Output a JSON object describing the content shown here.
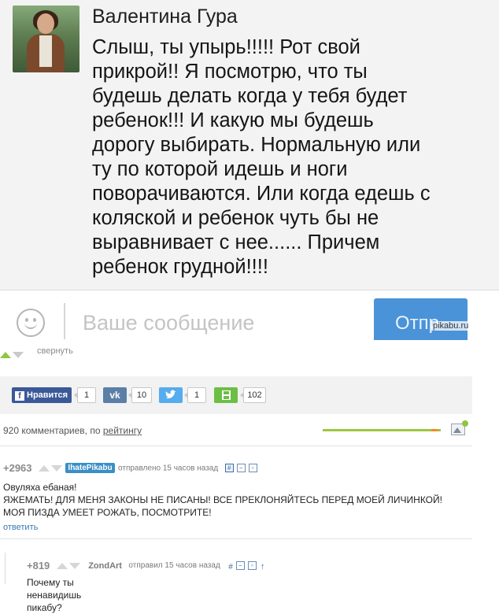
{
  "chat": {
    "sender_name": "Валентина Гура",
    "message_lines": [
      "Слыш, ты упырь!!!!! Рот свой",
      "прикрой!! Я посмотрю, что ты",
      "будешь делать когда у тебя будет",
      "ребенок!!! И какую мы будешь",
      "дорогу выбирать. Нормальную или",
      "ту по которой идешь и ноги",
      "поворачиваются. Или когда едешь с",
      "коляской и ребенок чуть бы не",
      "выравнивает с нее...... Причем",
      "ребенок грудной!!!!"
    ],
    "input_placeholder": "Ваше сообщение",
    "send_label": "Отпр"
  },
  "watermark": "pikabu.ru",
  "post": {
    "collapse_label": "свернуть",
    "share": [
      {
        "label": "Нравится",
        "count": "1",
        "color": "#3b5998",
        "icon": "facebook-icon"
      },
      {
        "label": "",
        "count": "10",
        "color": "#5b7fa6",
        "icon": "vk-icon"
      },
      {
        "label": "",
        "count": "1",
        "color": "#55acee",
        "icon": "twitter-icon"
      },
      {
        "label": "",
        "count": "102",
        "color": "#6cbf44",
        "icon": "save-icon"
      }
    ],
    "comments_count_text": "920 комментариев, по",
    "sort_label": "рейтингу"
  },
  "comments": [
    {
      "score": "+2963",
      "author": "IhatePikabu",
      "meta": "отправлено 15 часов назад",
      "text_lines": [
        "Овуляха ебаная!",
        "ЯЖЕМАТЬ! ДЛЯ МЕНЯ ЗАКОНЫ НЕ ПИСАНЫ! ВСЕ ПРЕКЛОНЯЙТЕСЬ ПЕРЕД МОЕЙ ЛИЧИНКОЙ!",
        "МОЯ ПИЗДА УМЕЕТ РОЖАТЬ, ПОСМОТРИТЕ!"
      ],
      "reply_label": "ответить"
    },
    {
      "score": "+819",
      "author": "ZondArt",
      "meta": "отправил 15 часов назад",
      "text_lines": [
        "Почему ты ненавидишь пикабу?"
      ]
    }
  ]
}
